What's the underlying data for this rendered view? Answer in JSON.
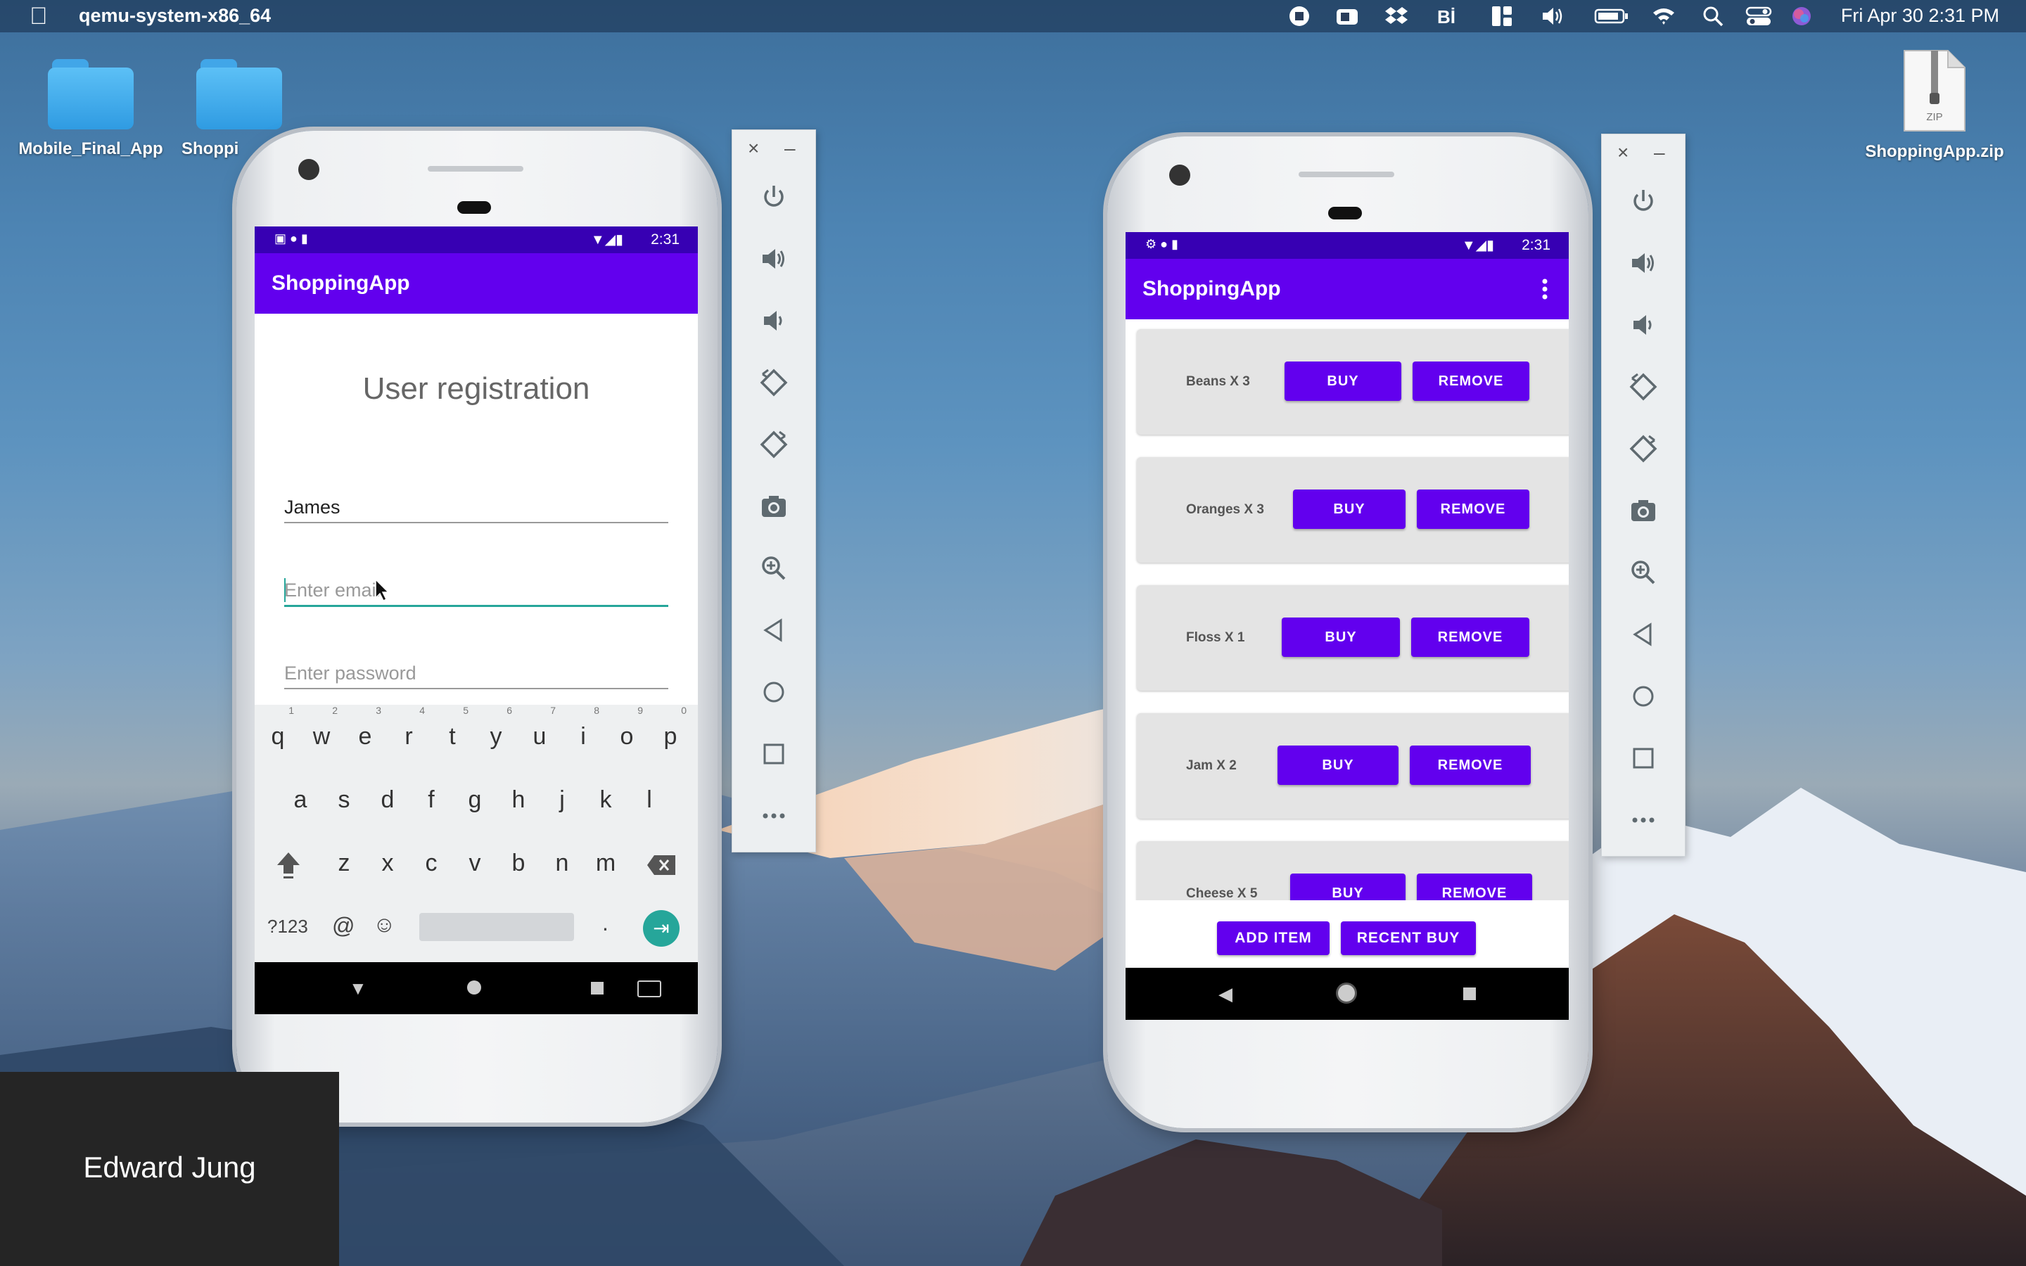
{
  "menubar": {
    "app_name": "qemu-system-x86_64",
    "clock": "Fri Apr 30  2:31 PM",
    "icons": [
      "stop-record-icon",
      "camera-icon",
      "dropbox-icon",
      "bi-icon",
      "layout-icon",
      "volume-icon",
      "battery-icon",
      "wifi-icon",
      "search-icon",
      "control-center-icon",
      "siri-icon"
    ]
  },
  "desktop": {
    "icons": [
      {
        "label": "Mobile_Final_App"
      },
      {
        "label": "Shoppi"
      },
      {
        "label": "ShoppingApp.zip",
        "badge": "ZIP"
      }
    ]
  },
  "left_phone": {
    "status_time": "2:31",
    "app_title": "ShoppingApp",
    "heading": "User registration",
    "name_value": "James",
    "email_placeholder": "Enter email",
    "password_placeholder": "Enter password",
    "keyboard": {
      "row1": [
        "q",
        "w",
        "e",
        "r",
        "t",
        "y",
        "u",
        "i",
        "o",
        "p"
      ],
      "row1_nums": [
        "1",
        "2",
        "3",
        "4",
        "5",
        "6",
        "7",
        "8",
        "9",
        "0"
      ],
      "row2": [
        "a",
        "s",
        "d",
        "f",
        "g",
        "h",
        "j",
        "k",
        "l"
      ],
      "row3": [
        "z",
        "x",
        "c",
        "v",
        "b",
        "n",
        "m"
      ],
      "sym_key": "?123",
      "at_key": "@",
      "period_key": "."
    }
  },
  "right_phone": {
    "status_time": "2:31",
    "app_title": "ShoppingApp",
    "items": [
      {
        "label": "Beans X 3",
        "buy": "BUY",
        "remove": "REMOVE"
      },
      {
        "label": "Oranges X 3",
        "buy": "BUY",
        "remove": "REMOVE"
      },
      {
        "label": "Floss X 1",
        "buy": "BUY",
        "remove": "REMOVE"
      },
      {
        "label": "Jam X 2",
        "buy": "BUY",
        "remove": "REMOVE"
      },
      {
        "label": "Cheese X 5",
        "buy": "BUY",
        "remove": "REMOVE"
      }
    ],
    "add_item": "ADD ITEM",
    "recent_buy": "RECENT BUY"
  },
  "emulator_toolbar": {
    "close": "×",
    "minimize": "–",
    "tools": [
      "power-icon",
      "volume-up-icon",
      "volume-down-icon",
      "rotate-left-icon",
      "rotate-right-icon",
      "screenshot-icon",
      "zoom-icon",
      "back-icon",
      "home-icon",
      "overview-icon",
      "more-icon"
    ]
  },
  "participant": {
    "name": "Edward Jung"
  },
  "colors": {
    "primary": "#6200ee",
    "primary_dark": "#3700b3",
    "accent": "#26a69a"
  }
}
